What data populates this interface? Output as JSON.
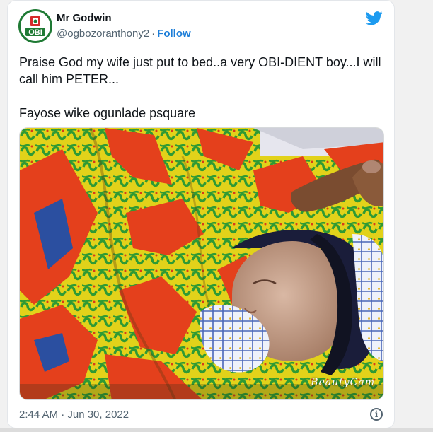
{
  "tweet": {
    "author_name": "Mr Godwin",
    "handle": "@ogbozoranthony2",
    "separator": "·",
    "follow_label": "Follow",
    "avatar_logo_text": "OBI",
    "text_line1": "Praise God my wife just put to bed..a very OBI-DIENT boy...I will call him PETER...",
    "text_line2": "Fayose wike ogunlade psquare",
    "photo_watermark": "BeautyCam",
    "timestamp": "2:44 AM · Jun 30, 2022",
    "info_symbol": "i"
  },
  "colors": {
    "follow": "#1d7ed8",
    "twitter_blue": "#1d9bf0",
    "text": "#0f1419",
    "muted": "#536471",
    "avatar_ring": "#1f7a34",
    "avatar_red": "#d62b2b"
  },
  "icons": [
    "avatar-logo",
    "twitter-bird-icon",
    "info-icon"
  ]
}
